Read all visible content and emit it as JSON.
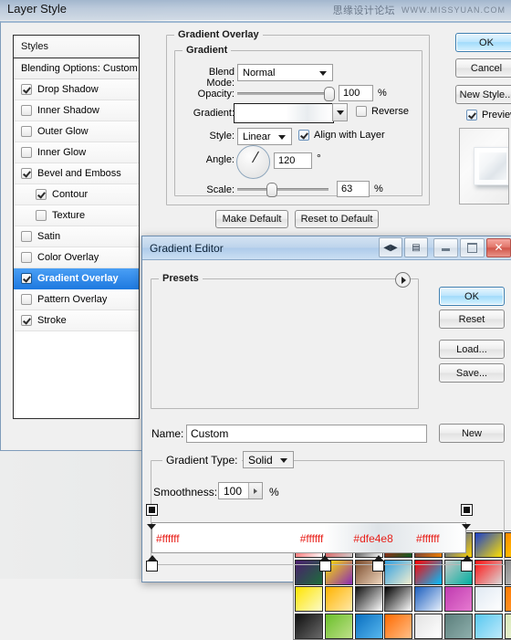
{
  "desktop": {
    "watermark_cn": "思缘设计论坛",
    "watermark_en": "WWW.MISSYUAN.COM"
  },
  "layer_style": {
    "title": "Layer Style",
    "styles_header": "Styles",
    "blending_options": "Blending Options: Custom",
    "effects": [
      {
        "label": "Drop Shadow",
        "checked": true,
        "sub": false,
        "selected": false
      },
      {
        "label": "Inner Shadow",
        "checked": false,
        "sub": false,
        "selected": false
      },
      {
        "label": "Outer Glow",
        "checked": false,
        "sub": false,
        "selected": false
      },
      {
        "label": "Inner Glow",
        "checked": false,
        "sub": false,
        "selected": false
      },
      {
        "label": "Bevel and Emboss",
        "checked": true,
        "sub": false,
        "selected": false
      },
      {
        "label": "Contour",
        "checked": true,
        "sub": true,
        "selected": false
      },
      {
        "label": "Texture",
        "checked": false,
        "sub": true,
        "selected": false
      },
      {
        "label": "Satin",
        "checked": false,
        "sub": false,
        "selected": false
      },
      {
        "label": "Color Overlay",
        "checked": false,
        "sub": false,
        "selected": false
      },
      {
        "label": "Gradient Overlay",
        "checked": true,
        "sub": false,
        "selected": true
      },
      {
        "label": "Pattern Overlay",
        "checked": false,
        "sub": false,
        "selected": false
      },
      {
        "label": "Stroke",
        "checked": true,
        "sub": false,
        "selected": false
      }
    ],
    "panel": {
      "section_title": "Gradient Overlay",
      "group_title": "Gradient",
      "blend_mode_label": "Blend Mode:",
      "blend_mode_value": "Normal",
      "opacity_label": "Opacity:",
      "opacity_value": "100",
      "opacity_unit": "%",
      "gradient_label": "Gradient:",
      "reverse_label": "Reverse",
      "reverse_checked": false,
      "style_label": "Style:",
      "style_value": "Linear",
      "align_label": "Align with Layer",
      "align_checked": true,
      "angle_label": "Angle:",
      "angle_value": "120",
      "angle_unit": "°",
      "scale_label": "Scale:",
      "scale_value": "63",
      "scale_unit": "%",
      "make_default": "Make Default",
      "reset_to_default": "Reset to Default"
    },
    "buttons": {
      "ok": "OK",
      "cancel": "Cancel",
      "new_style": "New Style...",
      "preview_label": "Preview",
      "preview_checked": true
    }
  },
  "gradient_editor": {
    "title": "Gradient Editor",
    "titlebar_icons": [
      "prev-next-icon",
      "panel-menu-icon",
      "minimize-icon",
      "maximize-icon",
      "close-icon"
    ],
    "presets_group": "Presets",
    "presets": [
      [
        "#f41f1f",
        "#ffffff"
      ],
      [
        "#e22222",
        "#cfcfcf"
      ],
      [
        "#000000",
        "#ffffff"
      ],
      [
        "#e01010",
        "#0d5c22"
      ],
      [
        "#2a1a5e",
        "#f08000"
      ],
      [
        "#1a3fcc",
        "#ffd400"
      ],
      [
        "#1a3fcc",
        "#ffe000"
      ],
      [
        "#ff8a00",
        "#ffe400"
      ],
      [
        "#4b1d6e",
        "#1d6e3b"
      ],
      [
        "#ffe400",
        "#8a2bb5"
      ],
      [
        "#7a4a2a",
        "#f0d8c0"
      ],
      [
        "#2f9ee0",
        "#f5f0d0"
      ],
      [
        "#ff0000",
        "#00c0ff"
      ],
      [
        "#c8c8c8",
        "#00b0a0"
      ],
      [
        "#ff1111",
        "#d9d9d9"
      ],
      [
        "#888888",
        "#cfcfcf"
      ],
      [
        "#ffe400",
        "#fbfbc8"
      ],
      [
        "#ffb300",
        "#ffe9a8"
      ],
      [
        "#111111",
        "#ffffff"
      ],
      [
        "#000000",
        "#ffffff"
      ],
      [
        "#1d5fbf",
        "#e8f0fb"
      ],
      [
        "#c03bb0",
        "#e67ad0"
      ],
      [
        "#dfe8f2",
        "#ffffff"
      ],
      [
        "#ff7a00",
        "#ffa040"
      ],
      [
        "#101010",
        "#6a6a6a"
      ],
      [
        "#6abf2a",
        "#bfe08a"
      ],
      [
        "#0a6fc0",
        "#58b8ef"
      ],
      [
        "#ff6a00",
        "#ffc08a"
      ],
      [
        "#e2e2e2",
        "#ffffff"
      ],
      [
        "#5c7f7c",
        "#8fb0ad"
      ],
      [
        "#58c8f0",
        "#bfeafb"
      ],
      [
        "#d8e8b8",
        "#f0f6dc"
      ]
    ],
    "name_label": "Name:",
    "name_value": "Custom",
    "gradient_type_label": "Gradient Type:",
    "gradient_type_value": "Solid",
    "smoothness_label": "Smoothness:",
    "smoothness_value": "100",
    "smoothness_unit": "%",
    "buttons": {
      "ok": "OK",
      "reset": "Reset",
      "load": "Load...",
      "save": "Save...",
      "new": "New"
    },
    "gradient_stops": {
      "color_stops": [
        {
          "hex": "#ffffff",
          "position": 0
        },
        {
          "hex": "#ffffff",
          "position": 55
        },
        {
          "hex": "#dfe4e8",
          "position": 72
        },
        {
          "hex": "#ffffff",
          "position": 100
        }
      ],
      "opacity_stops": [
        {
          "position": 0
        },
        {
          "position": 100
        }
      ]
    }
  }
}
